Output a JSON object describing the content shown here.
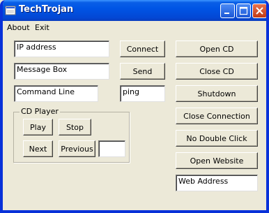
{
  "window": {
    "title": "TechTrojan",
    "colors": {
      "titlebar": "#0055e5",
      "border": "#0831d9",
      "face": "#ece9d8",
      "close": "#c13914"
    }
  },
  "menu": {
    "items": [
      "About",
      "Exit"
    ]
  },
  "fields": {
    "ip_address": "IP address",
    "message_box": "Message Box",
    "command_line": "Command Line",
    "ping": "ping",
    "web_address": "Web Address",
    "cd_extra": ""
  },
  "buttons": {
    "connect": "Connect",
    "send": "Send",
    "open_cd": "Open CD",
    "close_cd": "Close CD",
    "shutdown": "Shutdown",
    "close_connection": "Close Connection",
    "no_double_click": "No Double Click",
    "open_website": "Open Website"
  },
  "cd_player": {
    "label": "CD Player",
    "play": "Play",
    "stop": "Stop",
    "next": "Next",
    "previous": "Previous"
  }
}
